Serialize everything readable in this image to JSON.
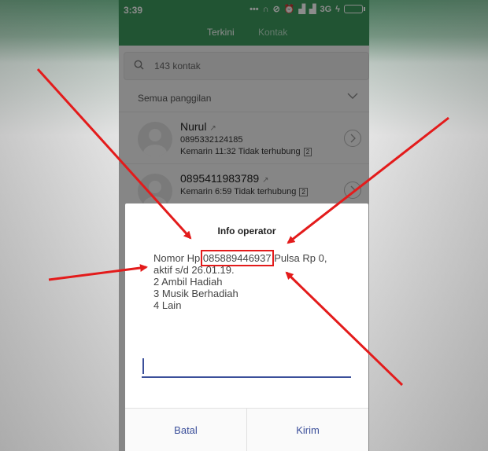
{
  "status_bar": {
    "time": "3:39",
    "network": "3G"
  },
  "tabs": [
    {
      "label": "Terkini",
      "active": true
    },
    {
      "label": "Kontak",
      "active": false
    }
  ],
  "search": {
    "placeholder": "143 kontak"
  },
  "section": {
    "label": "Semua panggilan"
  },
  "call_log": [
    {
      "name": "Nurul",
      "number": "0895332124185",
      "meta": "Kemarin 11:32 Tidak terhubung",
      "sim": "2"
    },
    {
      "name": "0895411983789",
      "number": "",
      "meta": "Kemarin 6:59 Tidak terhubung",
      "sim": "2"
    }
  ],
  "dialog": {
    "title": "Info operator",
    "msg_prefix": "Nomor Hp ",
    "msg_number": "085889446937",
    "msg_suffix": " Pulsa Rp 0,",
    "line2": "aktif s/d 26.01.19.",
    "line3": "2 Ambil Hadiah",
    "line4": "3 Musik Berhadiah",
    "line5": "4 Lain",
    "input_value": "",
    "cancel_label": "Batal",
    "send_label": "Kirim"
  },
  "colors": {
    "header_green": "#3d9a5e",
    "button_blue": "#3b4f9a",
    "highlight_red": "#e31b1b"
  }
}
